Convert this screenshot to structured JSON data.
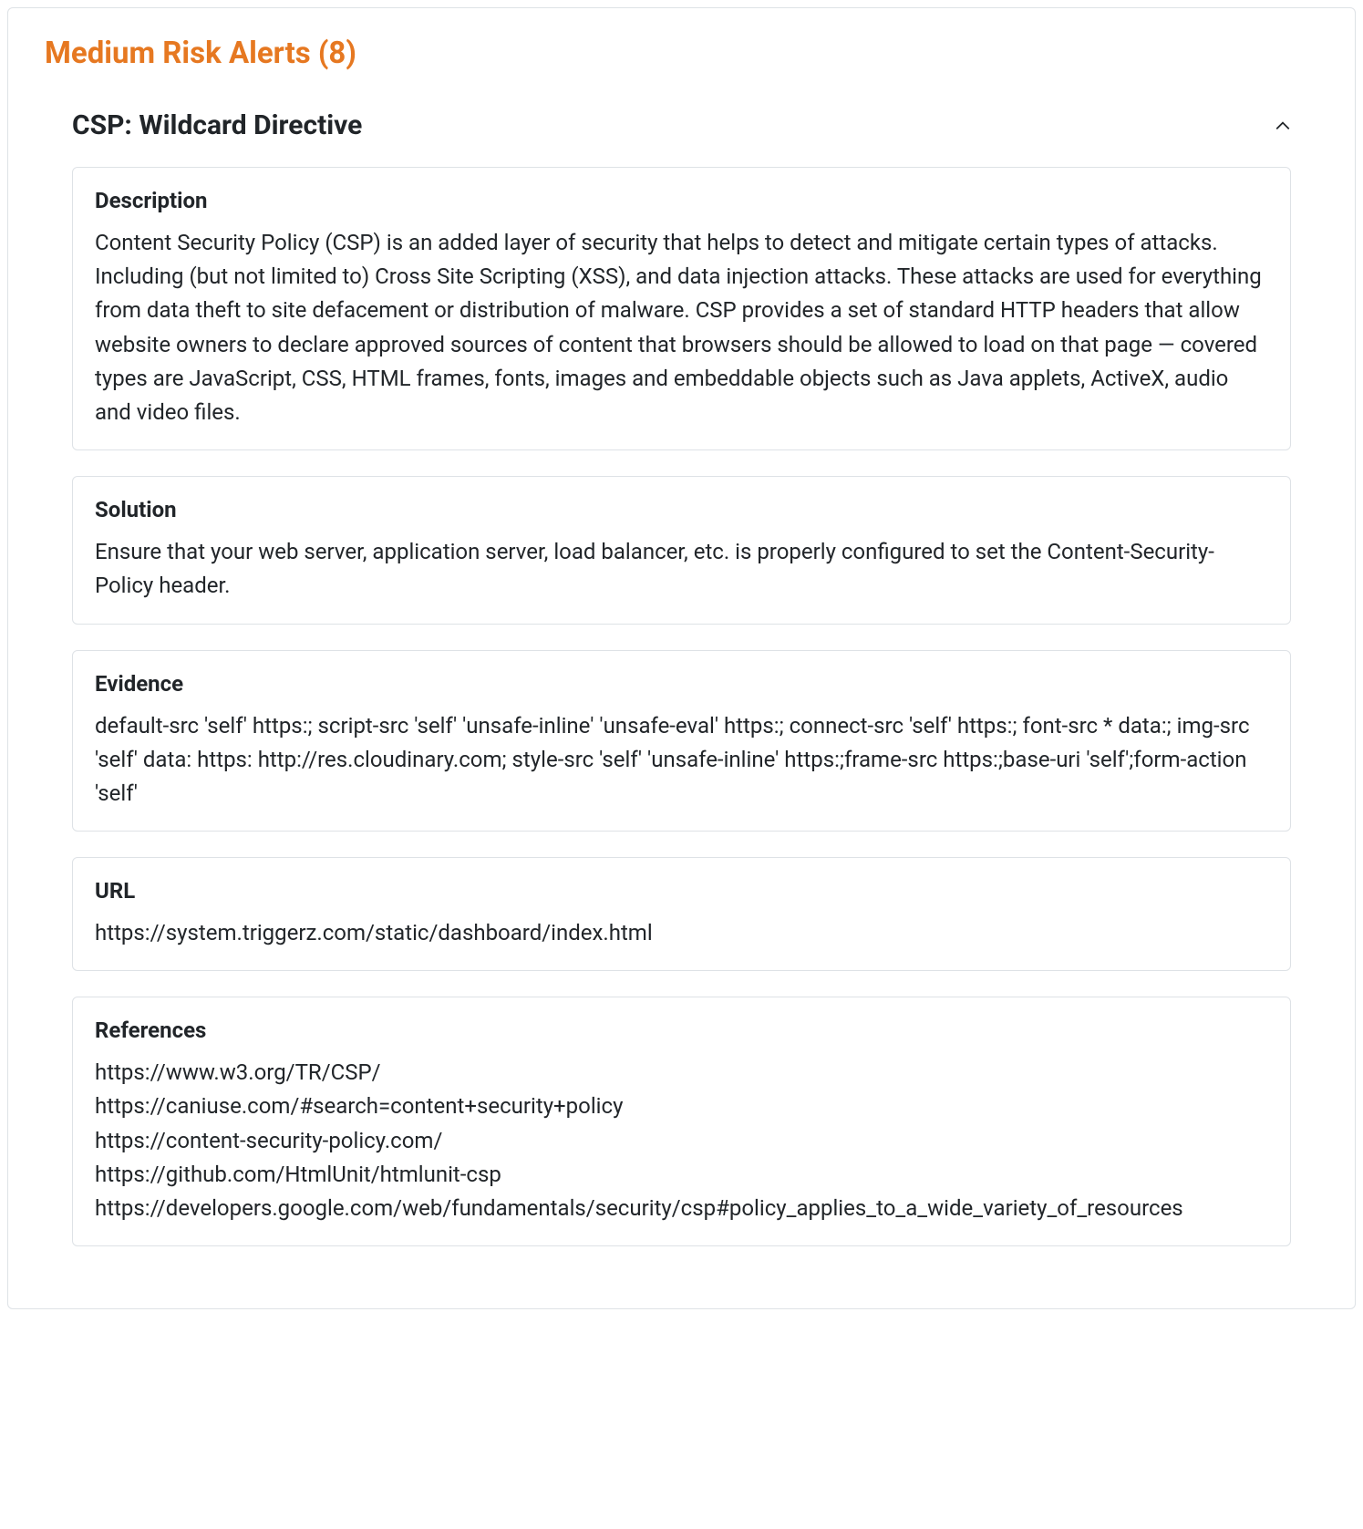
{
  "section": {
    "title": "Medium Risk Alerts (8)"
  },
  "alert": {
    "title": "CSP: Wildcard Directive",
    "cards": {
      "description": {
        "heading": "Description",
        "body": "Content Security Policy (CSP) is an added layer of security that helps to detect and mitigate certain types of attacks. Including (but not limited to) Cross Site Scripting (XSS), and data injection attacks. These attacks are used for everything from data theft to site defacement or distribution of malware. CSP provides a set of standard HTTP headers that allow website owners to declare approved sources of content that browsers should be allowed to load on that page — covered types are JavaScript, CSS, HTML frames, fonts, images and embeddable objects such as Java applets, ActiveX, audio and video files."
      },
      "solution": {
        "heading": "Solution",
        "body": "Ensure that your web server, application server, load balancer, etc. is properly configured to set the Content-Security-Policy header."
      },
      "evidence": {
        "heading": "Evidence",
        "body": "default-src 'self' https:; script-src 'self' 'unsafe-inline' 'unsafe-eval' https:; connect-src 'self' https:; font-src * data:; img-src 'self' data: https: http://res.cloudinary.com; style-src 'self' 'unsafe-inline' https:;frame-src https:;base-uri 'self';form-action 'self'"
      },
      "url": {
        "heading": "URL",
        "body": "https://system.triggerz.com/static/dashboard/index.html"
      },
      "references": {
        "heading": "References",
        "items": [
          "https://www.w3.org/TR/CSP/",
          "https://caniuse.com/#search=content+security+policy",
          "https://content-security-policy.com/",
          "https://github.com/HtmlUnit/htmlunit-csp",
          "https://developers.google.com/web/fundamentals/security/csp#policy_applies_to_a_wide_variety_of_resources"
        ]
      }
    }
  }
}
